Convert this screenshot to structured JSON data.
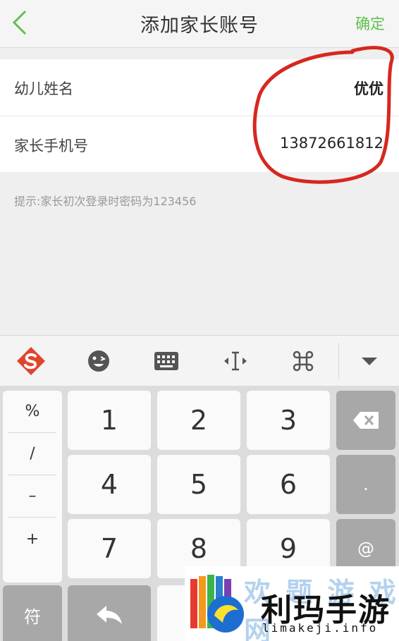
{
  "header": {
    "title": "添加家长账号",
    "confirm_label": "确定"
  },
  "form": {
    "fields": [
      {
        "label": "幼儿姓名",
        "value": "优优"
      },
      {
        "label": "家长手机号",
        "value": "13872661812"
      }
    ],
    "hint": "提示:家长初次登录时密码为123456"
  },
  "keyboard": {
    "toolbar": {
      "icons": [
        "sogou-logo-icon",
        "emoji-icon",
        "keyboard-icon",
        "cursor-move-icon",
        "command-icon",
        "collapse-keyboard-icon"
      ]
    },
    "side_symbols": [
      "%",
      "/",
      "–",
      "+"
    ],
    "keys": [
      "1",
      "2",
      "3",
      "4",
      "5",
      "6",
      "7",
      "8",
      "9"
    ],
    "dot_key": ".",
    "at_key": "@",
    "symbol_key": "符",
    "accent_color": "#5fc14c"
  },
  "watermark": {
    "text": "利玛手游",
    "url": "limakeji.info",
    "faded_text": "欢 题 游 戏 网"
  }
}
